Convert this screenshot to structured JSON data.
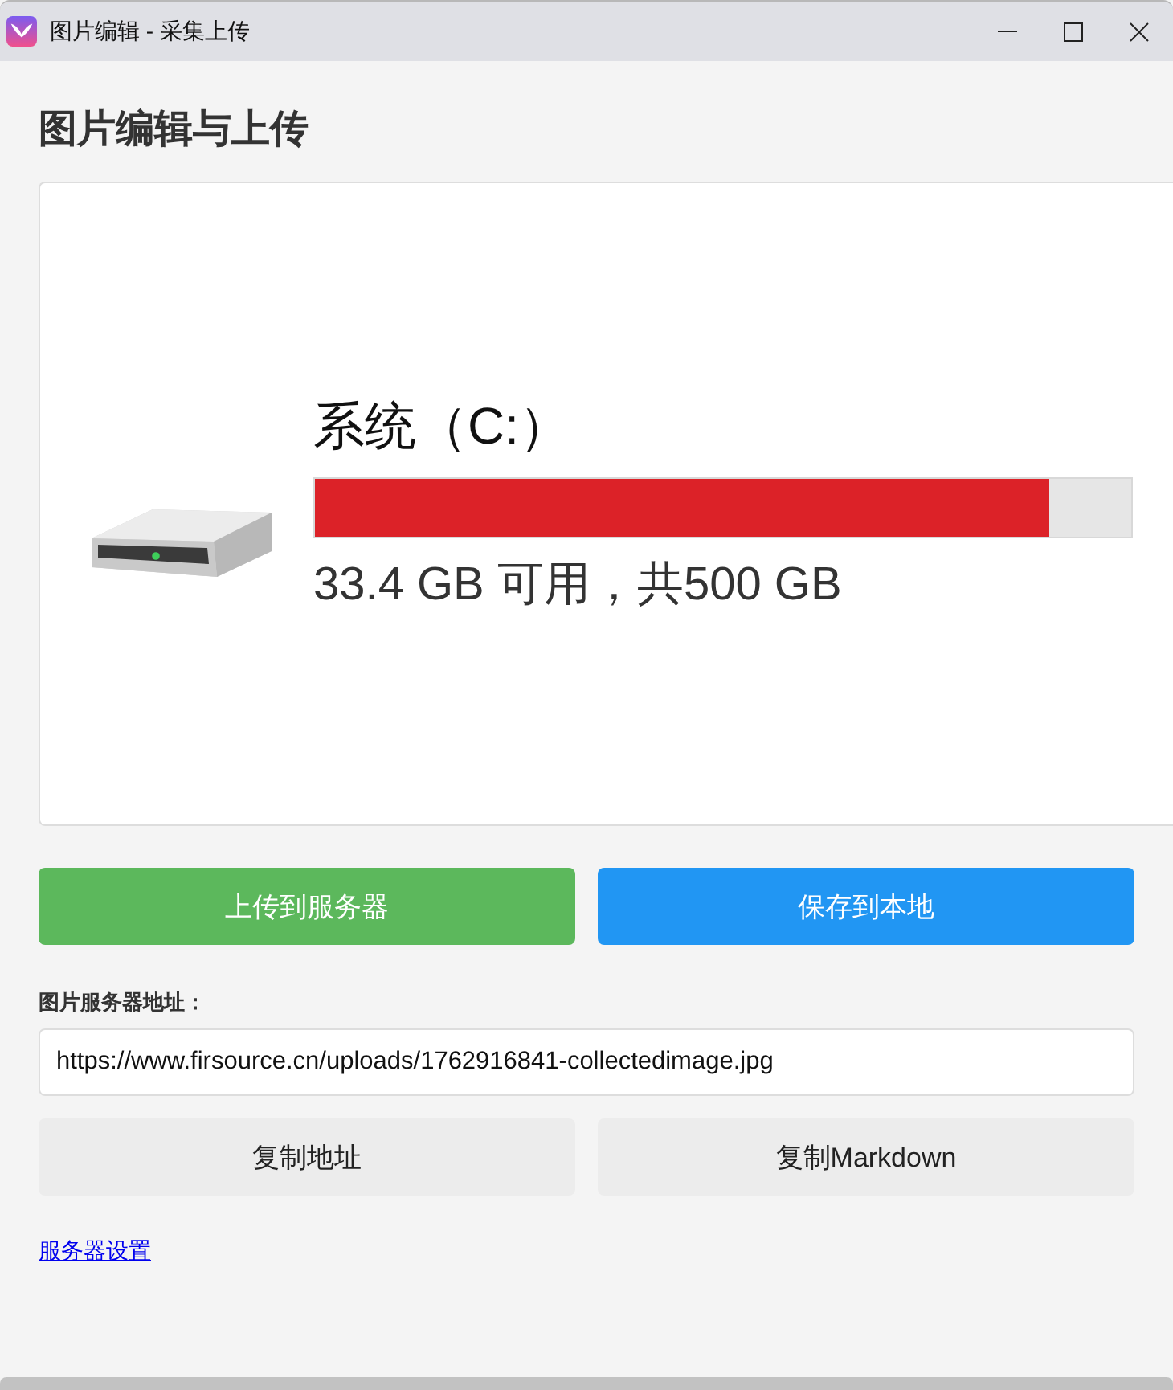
{
  "window": {
    "title": "图片编辑 - 采集上传"
  },
  "heading": "图片编辑与上传",
  "preview": {
    "drive_name": "系统（C:）",
    "usage": {
      "level": 0.9
    },
    "free_space": "33.4 GB 可用，共500 GB"
  },
  "actions": [
    {
      "label": "上传到服务器",
      "kind": "upload"
    },
    {
      "label": "保存到本地",
      "kind": "save"
    }
  ],
  "url_field": {
    "label": "图片服务器地址：",
    "value": "https://www.firsource.cn/uploads/1762916841-collectedimage.jpg"
  },
  "copy_buttons": [
    {
      "label": "复制地址"
    },
    {
      "label": "复制Markdown"
    }
  ],
  "settings_link": "服务器设置"
}
